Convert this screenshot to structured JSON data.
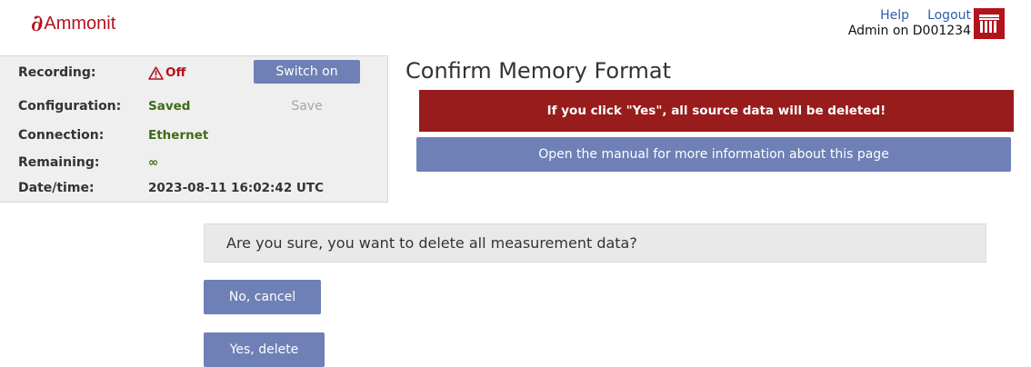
{
  "header": {
    "logo_mark": "∂",
    "logo_text": "Ammonit",
    "help_label": "Help",
    "logout_label": "Logout",
    "user_text": "Admin on D001234",
    "menu_icon": "app-menu-icon"
  },
  "status": {
    "recording_label": "Recording:",
    "recording_value": "Off",
    "configuration_label": "Configuration:",
    "configuration_value": "Saved",
    "connection_label": "Connection:",
    "connection_value": "Ethernet",
    "remaining_label": "Remaining:",
    "remaining_value": "∞",
    "datetime_label": "Date/time:",
    "datetime_value": "2023-08-11 16:02:42 UTC",
    "switch_on_label": "Switch on",
    "save_label": "Save"
  },
  "main": {
    "title": "Confirm Memory Format",
    "alert": "If you click \"Yes\", all source data will be deleted!",
    "manual_label": "Open the manual for more information about this page",
    "question": "Are you sure, you want to delete all measurement data?",
    "cancel_label": "No, cancel",
    "delete_label": "Yes, delete"
  },
  "colors": {
    "brand_red": "#b3131b",
    "alert_red": "#981c1c",
    "button_blue": "#6e80b5",
    "status_green": "#3f6b19"
  }
}
